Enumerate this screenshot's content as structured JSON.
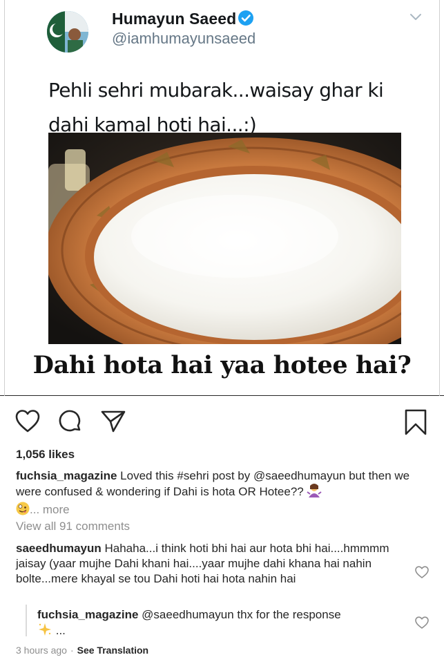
{
  "tweet": {
    "author_name": "Humayun Saeed",
    "author_handle": "@iamhumayunsaeed",
    "text": "Pehli sehri mubarak...waisay ghar ki dahi kamal hoti hai...:)",
    "meme_caption": "Dahi hota hai yaa hotee hai?",
    "icons": {
      "verified": "verified-badge-icon",
      "menu": "chevron-down-icon"
    },
    "colors": {
      "verified": "#1da1f2",
      "handle": "#657786"
    }
  },
  "post": {
    "likes": "1,056 likes",
    "caption": {
      "username": "fuchsia_magazine",
      "text_before": " Loved this ",
      "hashtag": "#sehri",
      "text_middle": " post by ",
      "mention": "@saeedhumayun",
      "text_after": " but then we were confused & wondering if Dahi is hota OR Hotee??",
      "more": "... more"
    },
    "view_all_comments": "View all 91 comments",
    "comments": [
      {
        "username": "saeedhumayun",
        "text": " Hahaha...i think hoti bhi hai aur hota bhi hai....hmmmm jaisay (yaar mujhe Dahi khani hai....yaar mujhe dahi khana hai nahin bolte...mere khayal se tou Dahi hoti hai hota nahin hai"
      }
    ],
    "reply": {
      "username": "fuchsia_magazine",
      "mention": " @saeedhumayun",
      "text": " thx for the response",
      "tail": " ..."
    },
    "timestamp": "3 hours ago",
    "separator": "·",
    "see_translation": "See Translation",
    "icons": [
      "heart-icon",
      "comment-icon",
      "share-icon",
      "bookmark-icon"
    ],
    "colors": {
      "muted": "#8e8e8e",
      "text": "#262626"
    }
  }
}
